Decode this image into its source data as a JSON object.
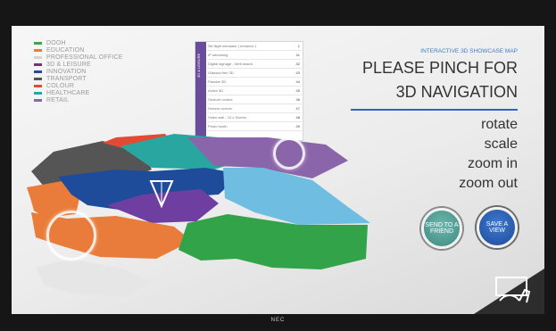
{
  "legend": [
    {
      "label": "DOOH",
      "color": "#3aa84a"
    },
    {
      "label": "EDUCATION",
      "color": "#e97c3a"
    },
    {
      "label": "PROFESSIONAL OFFICE",
      "color": "#d3d3d3"
    },
    {
      "label": "3D & LEISURE",
      "color": "#7a2f7b"
    },
    {
      "label": "INNOVATION",
      "color": "#1f4c9a"
    },
    {
      "label": "TRANSPORT",
      "color": "#545454"
    },
    {
      "label": "COLOUR",
      "color": "#e34a33"
    },
    {
      "label": "HEALTHCARE",
      "color": "#2aa6a0"
    },
    {
      "label": "RETAIL",
      "color": "#8b65aa"
    }
  ],
  "directory": {
    "side_label": "3D & LEISURE",
    "rows": [
      {
        "text": "Ski flight simulator ( entrance )",
        "num": "1"
      },
      {
        "text": "IP streaming",
        "num": "41"
      },
      {
        "text": "Digital signage - Web based",
        "num": "42"
      },
      {
        "text": "Glasses free 3D",
        "num": "43"
      },
      {
        "text": "Passive 3D",
        "num": "44"
      },
      {
        "text": "Active 3D",
        "num": "45"
      },
      {
        "text": "Gesture control",
        "num": "46"
      },
      {
        "text": "Horizon screen",
        "num": "47"
      },
      {
        "text": "Video wall - 10 x Screen",
        "num": "48"
      },
      {
        "text": "Photo booth",
        "num": "49"
      }
    ]
  },
  "header": {
    "subtitle": "INTERACTIVE 3D SHOWCASE MAP",
    "headline_line1": "PLEASE PINCH FOR",
    "headline_line2": "3D NAVIGATION"
  },
  "commands": [
    "rotate",
    "scale",
    "zoom in",
    "zoom out"
  ],
  "buttons": {
    "send": "SEND TO A FRIEND",
    "save": "SAVE A VIEW"
  },
  "brand": "NEC",
  "icons": {
    "gesture": "pinch-gesture-icon",
    "pointer": "location-pointer-icon"
  }
}
